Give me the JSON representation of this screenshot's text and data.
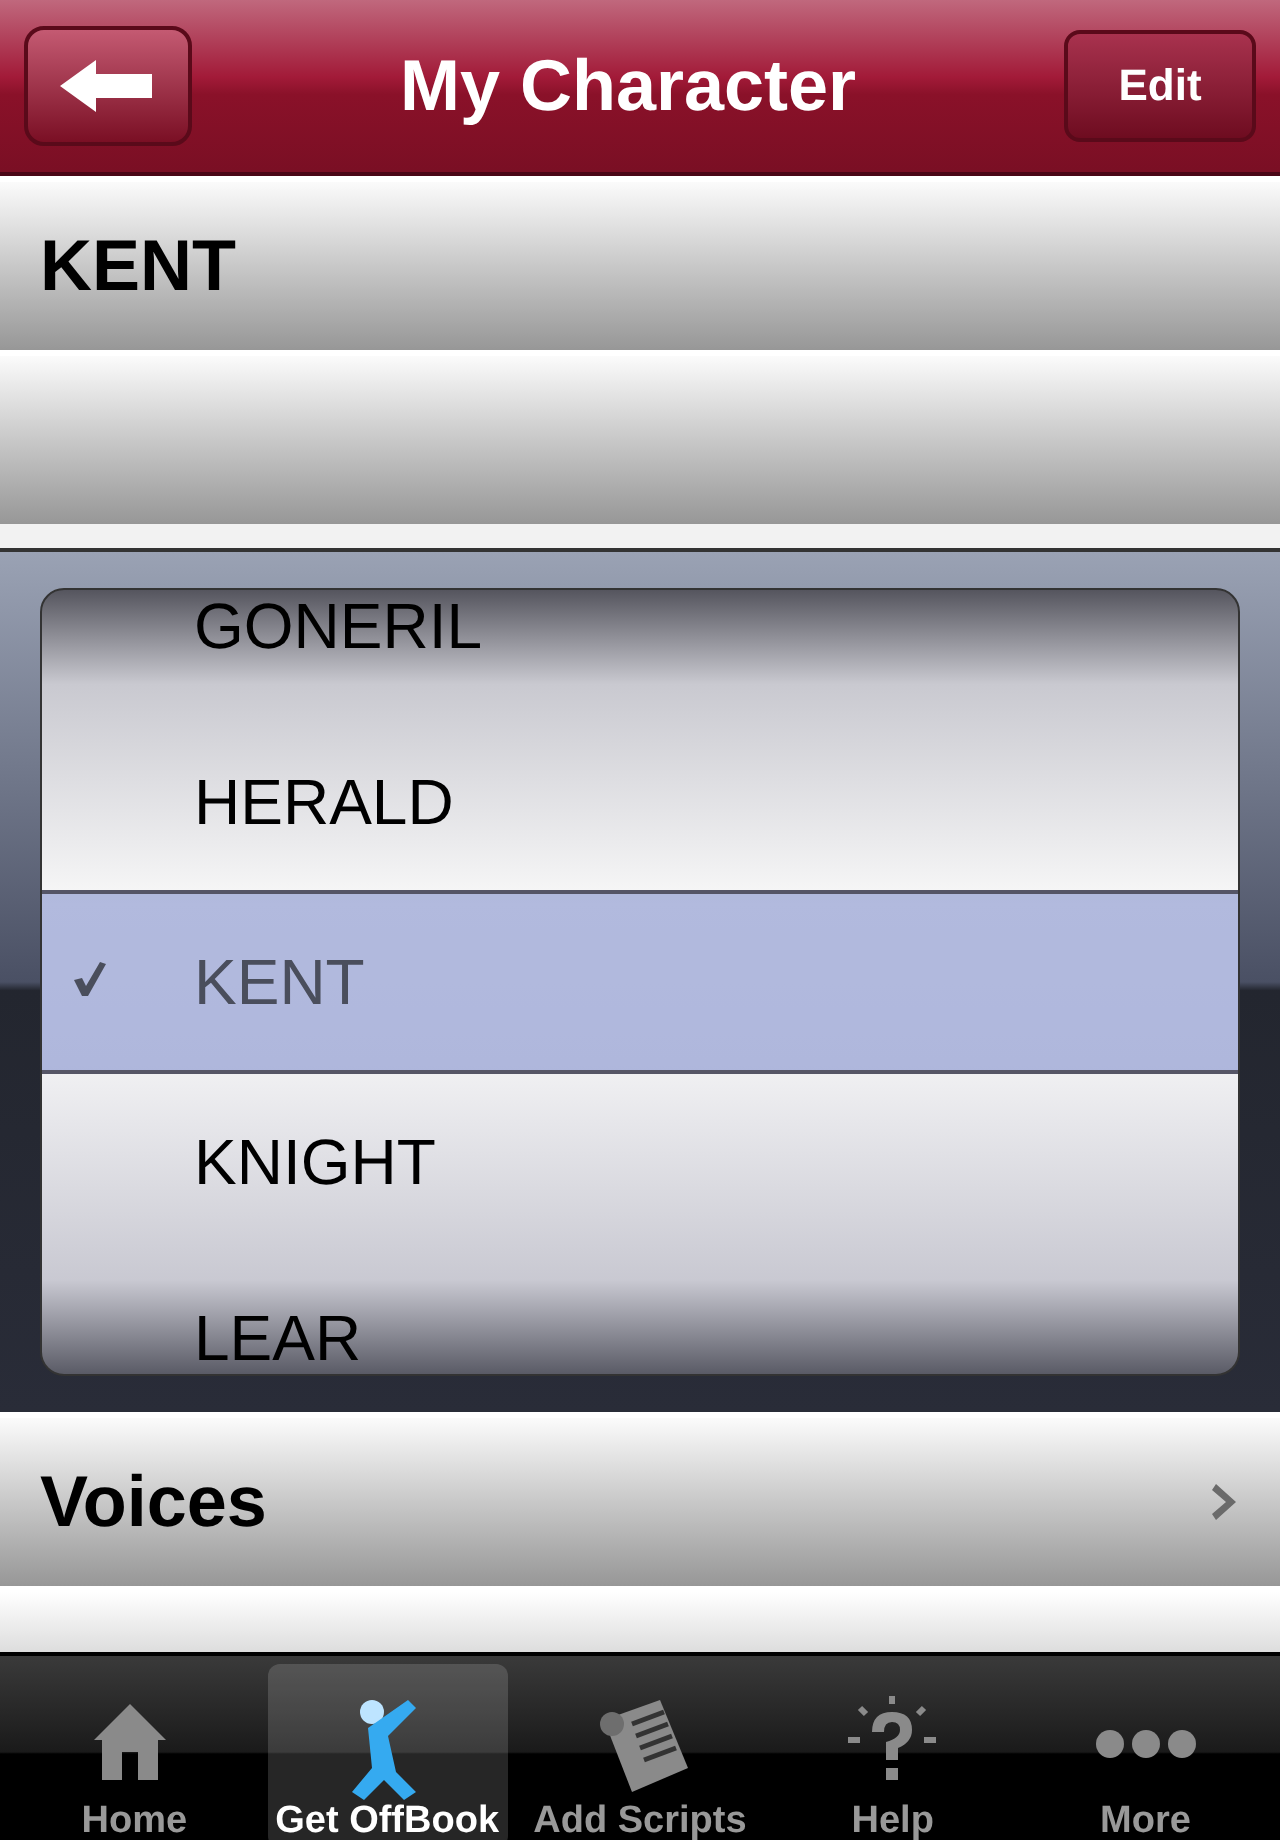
{
  "nav_bar": {
    "title": "My Character",
    "edit_button": "Edit"
  },
  "rows": [
    {
      "kind": "value",
      "label": "KENT"
    },
    {
      "kind": "empty"
    }
  ],
  "picker": {
    "items": [
      {
        "label": "GONERIL",
        "selected": false
      },
      {
        "label": "HERALD",
        "selected": false
      },
      {
        "label": "KENT",
        "selected": true
      },
      {
        "label": "KNIGHT",
        "selected": false
      },
      {
        "label": "LEAR",
        "selected": false
      }
    ]
  },
  "voices_row": {
    "label": "Voices"
  },
  "tab_bar": [
    {
      "label": "Home",
      "kind": "home",
      "selected": false
    },
    {
      "label": "Get OffBook",
      "kind": "figure",
      "selected": true
    },
    {
      "label": "Add Scripts",
      "kind": "scroll",
      "selected": false
    },
    {
      "label": "Help",
      "kind": "help",
      "selected": false
    },
    {
      "label": "More",
      "kind": "more",
      "selected": false
    }
  ]
}
